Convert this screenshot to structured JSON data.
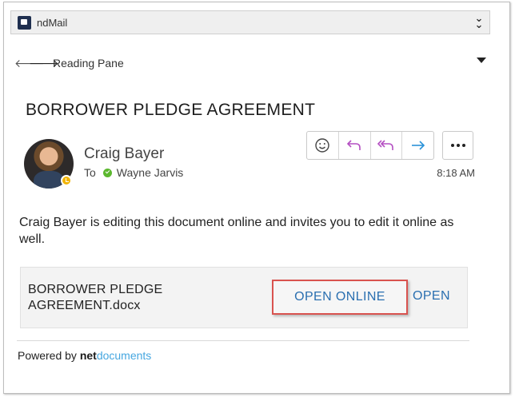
{
  "app": {
    "title": "ndMail",
    "logo_icon": "app-logo-icon",
    "collapse_icon": "double-chevron-down-icon"
  },
  "nav": {
    "label": "Reading Pane",
    "back_icon": "arrow-left-icon",
    "forward_icon": "arrow-right-icon",
    "dropdown_icon": "caret-down-icon"
  },
  "message": {
    "subject": "BORROWER PLEDGE AGREEMENT",
    "sender": "Craig Bayer",
    "to_label": "To",
    "recipient": "Wayne Jarvis",
    "time": "8:18 AM",
    "body": "Craig Bayer is editing this document online and invites you to edit it online as well."
  },
  "actions": [
    {
      "name": "emoji-react-button",
      "icon": "smiley-icon"
    },
    {
      "name": "reply-button",
      "icon": "reply-icon"
    },
    {
      "name": "reply-all-button",
      "icon": "reply-all-icon"
    },
    {
      "name": "forward-button",
      "icon": "forward-icon"
    }
  ],
  "attachment": {
    "filename": "BORROWER PLEDGE AGREEMENT.docx",
    "open_online_label": "OPEN ONLINE",
    "open_label": "OPEN"
  },
  "footer": {
    "powered_by": "Powered by",
    "brand_net": "net",
    "brand_docs": "documents"
  },
  "colors": {
    "link_blue": "#2a6fb0",
    "highlight_red": "#d9534f",
    "reply_purple": "#b44fc2",
    "forward_blue": "#2a92d8",
    "presence_green": "#5cb82f",
    "presence_yellow": "#f2b400"
  }
}
